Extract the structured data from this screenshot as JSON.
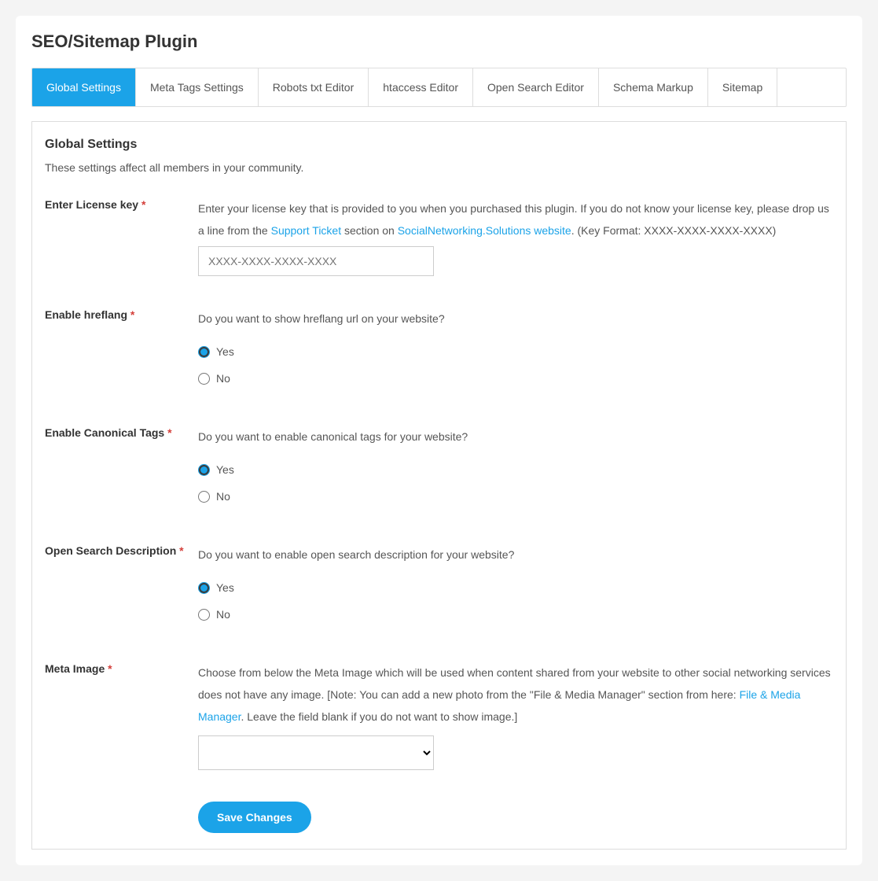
{
  "page": {
    "title": "SEO/Sitemap Plugin"
  },
  "tabs": [
    {
      "label": "Global Settings",
      "active": true
    },
    {
      "label": "Meta Tags Settings",
      "active": false
    },
    {
      "label": "Robots txt Editor",
      "active": false
    },
    {
      "label": "htaccess Editor",
      "active": false
    },
    {
      "label": "Open Search Editor",
      "active": false
    },
    {
      "label": "Schema Markup",
      "active": false
    },
    {
      "label": "Sitemap",
      "active": false
    }
  ],
  "panel": {
    "title": "Global Settings",
    "subtitle": "These settings affect all members in your community."
  },
  "fields": {
    "license": {
      "label": "Enter License key",
      "desc_part1": "Enter your license key that is provided to you when you purchased this plugin. If you do not know your license key, please drop us a line from the ",
      "link1": "Support Ticket",
      "desc_part2": " section on ",
      "link2": "SocialNetworking.Solutions website",
      "desc_part3": ". (Key Format: XXXX-XXXX-XXXX-XXXX)",
      "placeholder": "XXXX-XXXX-XXXX-XXXX",
      "value": ""
    },
    "hreflang": {
      "label": "Enable hreflang",
      "desc": "Do you want to show hreflang url on your website?",
      "yes": "Yes",
      "no": "No",
      "selected": "yes"
    },
    "canonical": {
      "label": "Enable Canonical Tags",
      "desc": "Do you want to enable canonical tags for your website?",
      "yes": "Yes",
      "no": "No",
      "selected": "yes"
    },
    "opensearch": {
      "label": "Open Search Description",
      "desc": "Do you want to enable open search description for your website?",
      "yes": "Yes",
      "no": "No",
      "selected": "yes"
    },
    "metaimage": {
      "label": "Meta Image",
      "desc_part1": "Choose from below the Meta Image which will be used when content shared from your website to other social networking services does not have any image. [Note: You can add a new photo from the \"File & Media Manager\" section from here: ",
      "link1": "File & Media Manager",
      "desc_part2": ". Leave the field blank if you do not want to show image.]",
      "selected": ""
    }
  },
  "buttons": {
    "save": "Save Changes"
  }
}
